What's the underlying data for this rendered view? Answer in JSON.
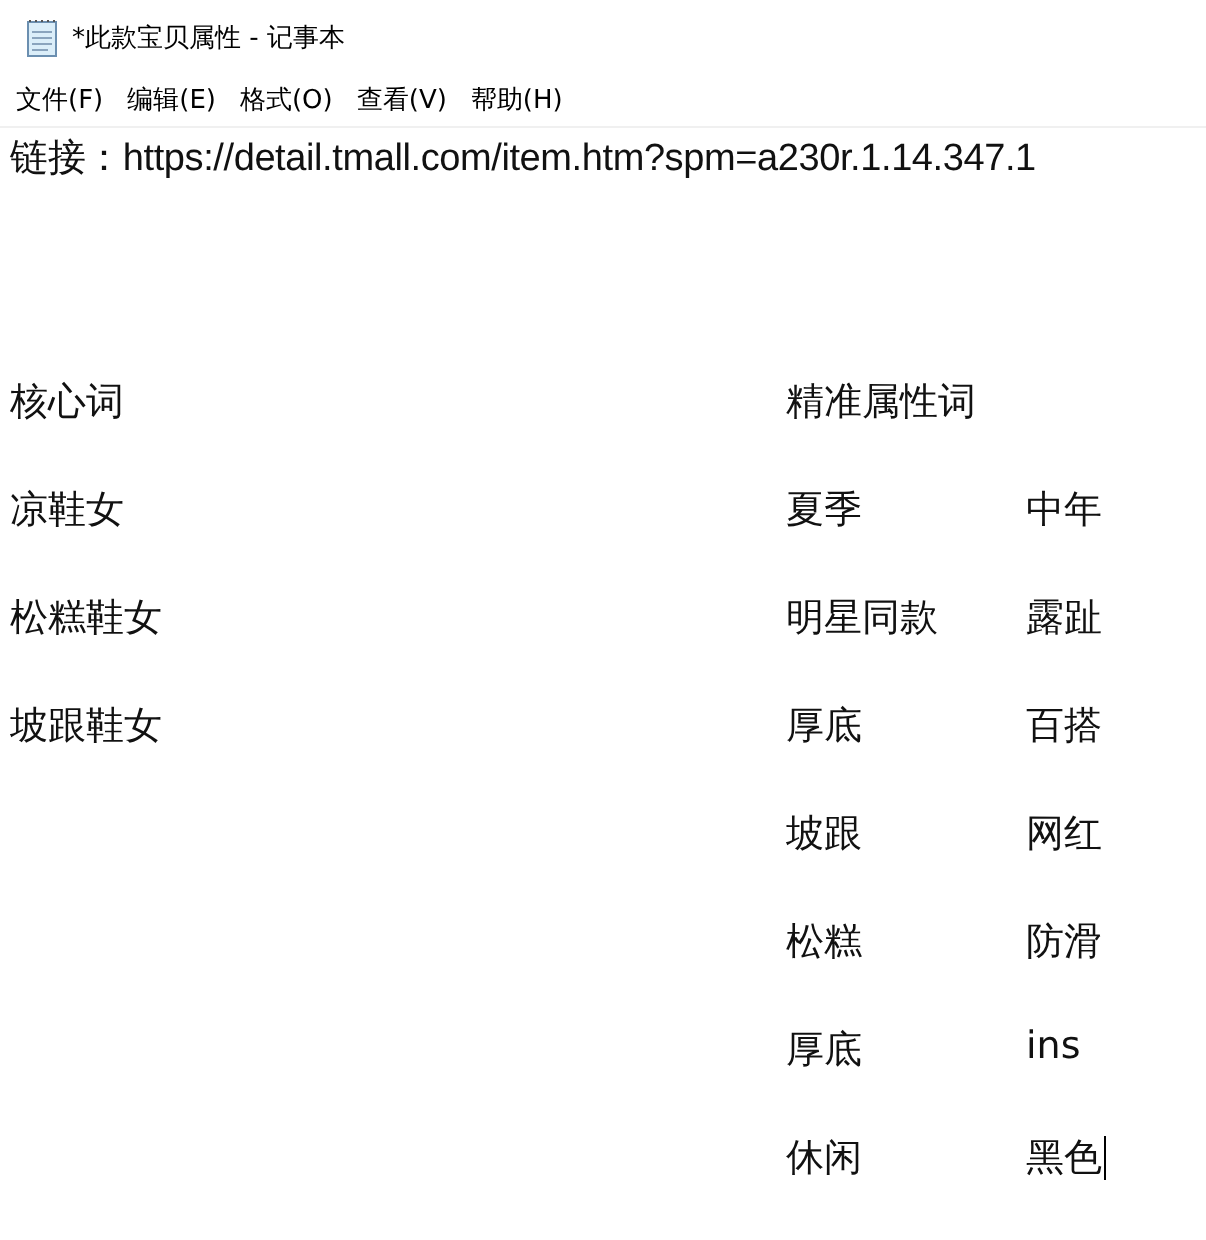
{
  "window": {
    "title": "*此款宝贝属性 - 记事本"
  },
  "menu": [
    "文件(F)",
    "编辑(E)",
    "格式(O)",
    "查看(V)",
    "帮助(H)"
  ],
  "document": {
    "link_line": "链接：https://detail.tmall.com/item.htm?spm=a230r.1.14.347.1",
    "headers": [
      "核心词",
      "精准属性词"
    ],
    "rows": [
      [
        "凉鞋女",
        "夏季",
        "中年"
      ],
      [
        "松糕鞋女",
        "明星同款",
        "露趾"
      ],
      [
        "坡跟鞋女",
        "厚底",
        "百搭"
      ],
      [
        "",
        "坡跟",
        "网红"
      ],
      [
        "",
        "松糕",
        "防滑"
      ],
      [
        "",
        "厚底",
        "ins"
      ],
      [
        "",
        "休闲",
        "黑色"
      ]
    ]
  }
}
